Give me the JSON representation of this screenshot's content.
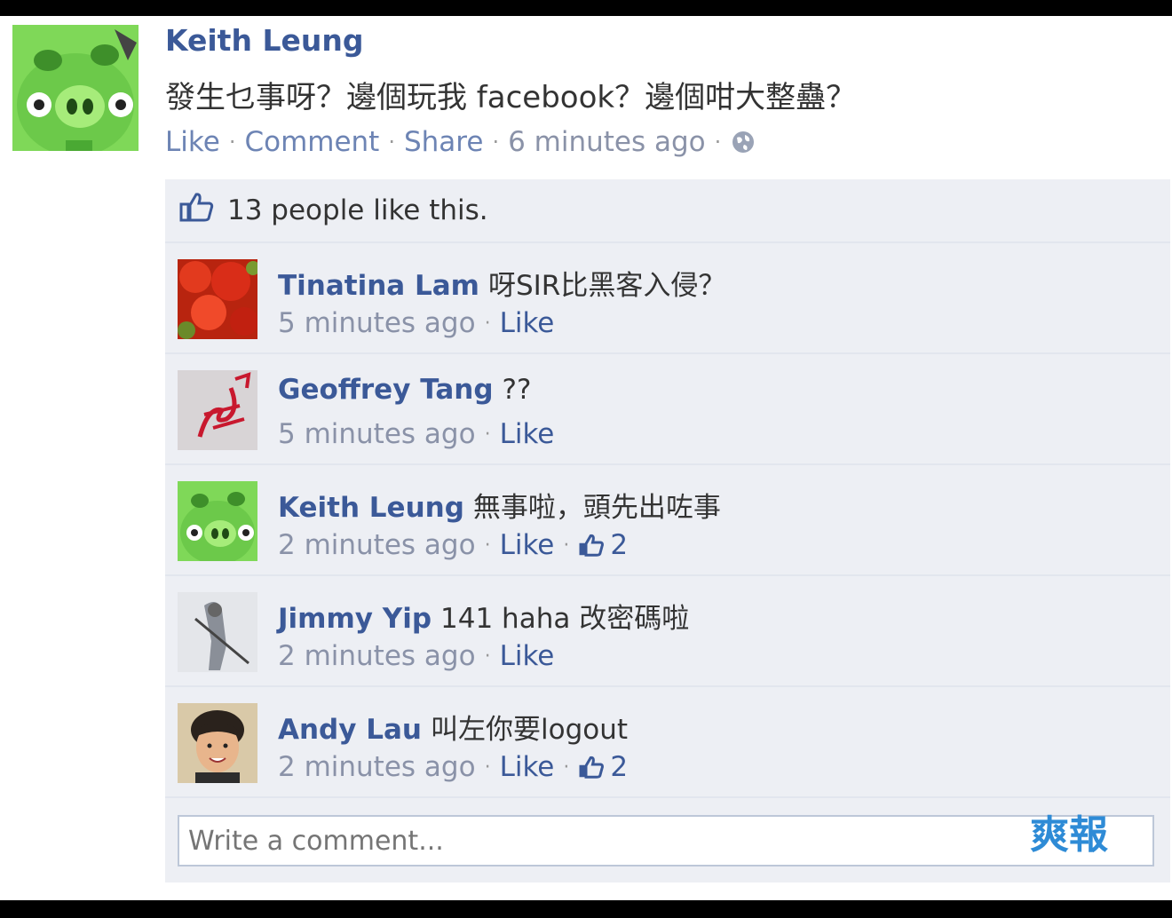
{
  "post": {
    "author": "Keith Leung",
    "text": "發生乜事呀？邊個玩我 facebook？邊個咁大整蠱？",
    "actions": {
      "like": "Like",
      "comment": "Comment",
      "share": "Share"
    },
    "timestamp": "6 minutes ago",
    "likes_text": "13 people like this."
  },
  "comments": [
    {
      "name": "Tinatina Lam",
      "text": "呀SIR比黑客入侵？",
      "time": "5 minutes ago",
      "like": "Like",
      "likes": ""
    },
    {
      "name": "Geoffrey Tang",
      "text": "??",
      "time": "5 minutes ago",
      "like": "Like",
      "likes": ""
    },
    {
      "name": "Keith Leung",
      "text": "無事啦，頭先出咗事",
      "time": "2 minutes ago",
      "like": "Like",
      "likes": "2"
    },
    {
      "name": "Jimmy Yip",
      "text": "141 haha 改密碼啦",
      "time": "2 minutes ago",
      "like": "Like",
      "likes": ""
    },
    {
      "name": "Andy Lau",
      "text": "叫左你要logout",
      "time": "2 minutes ago",
      "like": "Like",
      "likes": "2"
    }
  ],
  "composer": {
    "placeholder": "Write a comment..."
  },
  "watermark": "爽報",
  "colors": {
    "link": "#3b5998",
    "thread_bg": "#edeff4",
    "meta": "#8a92a8"
  }
}
